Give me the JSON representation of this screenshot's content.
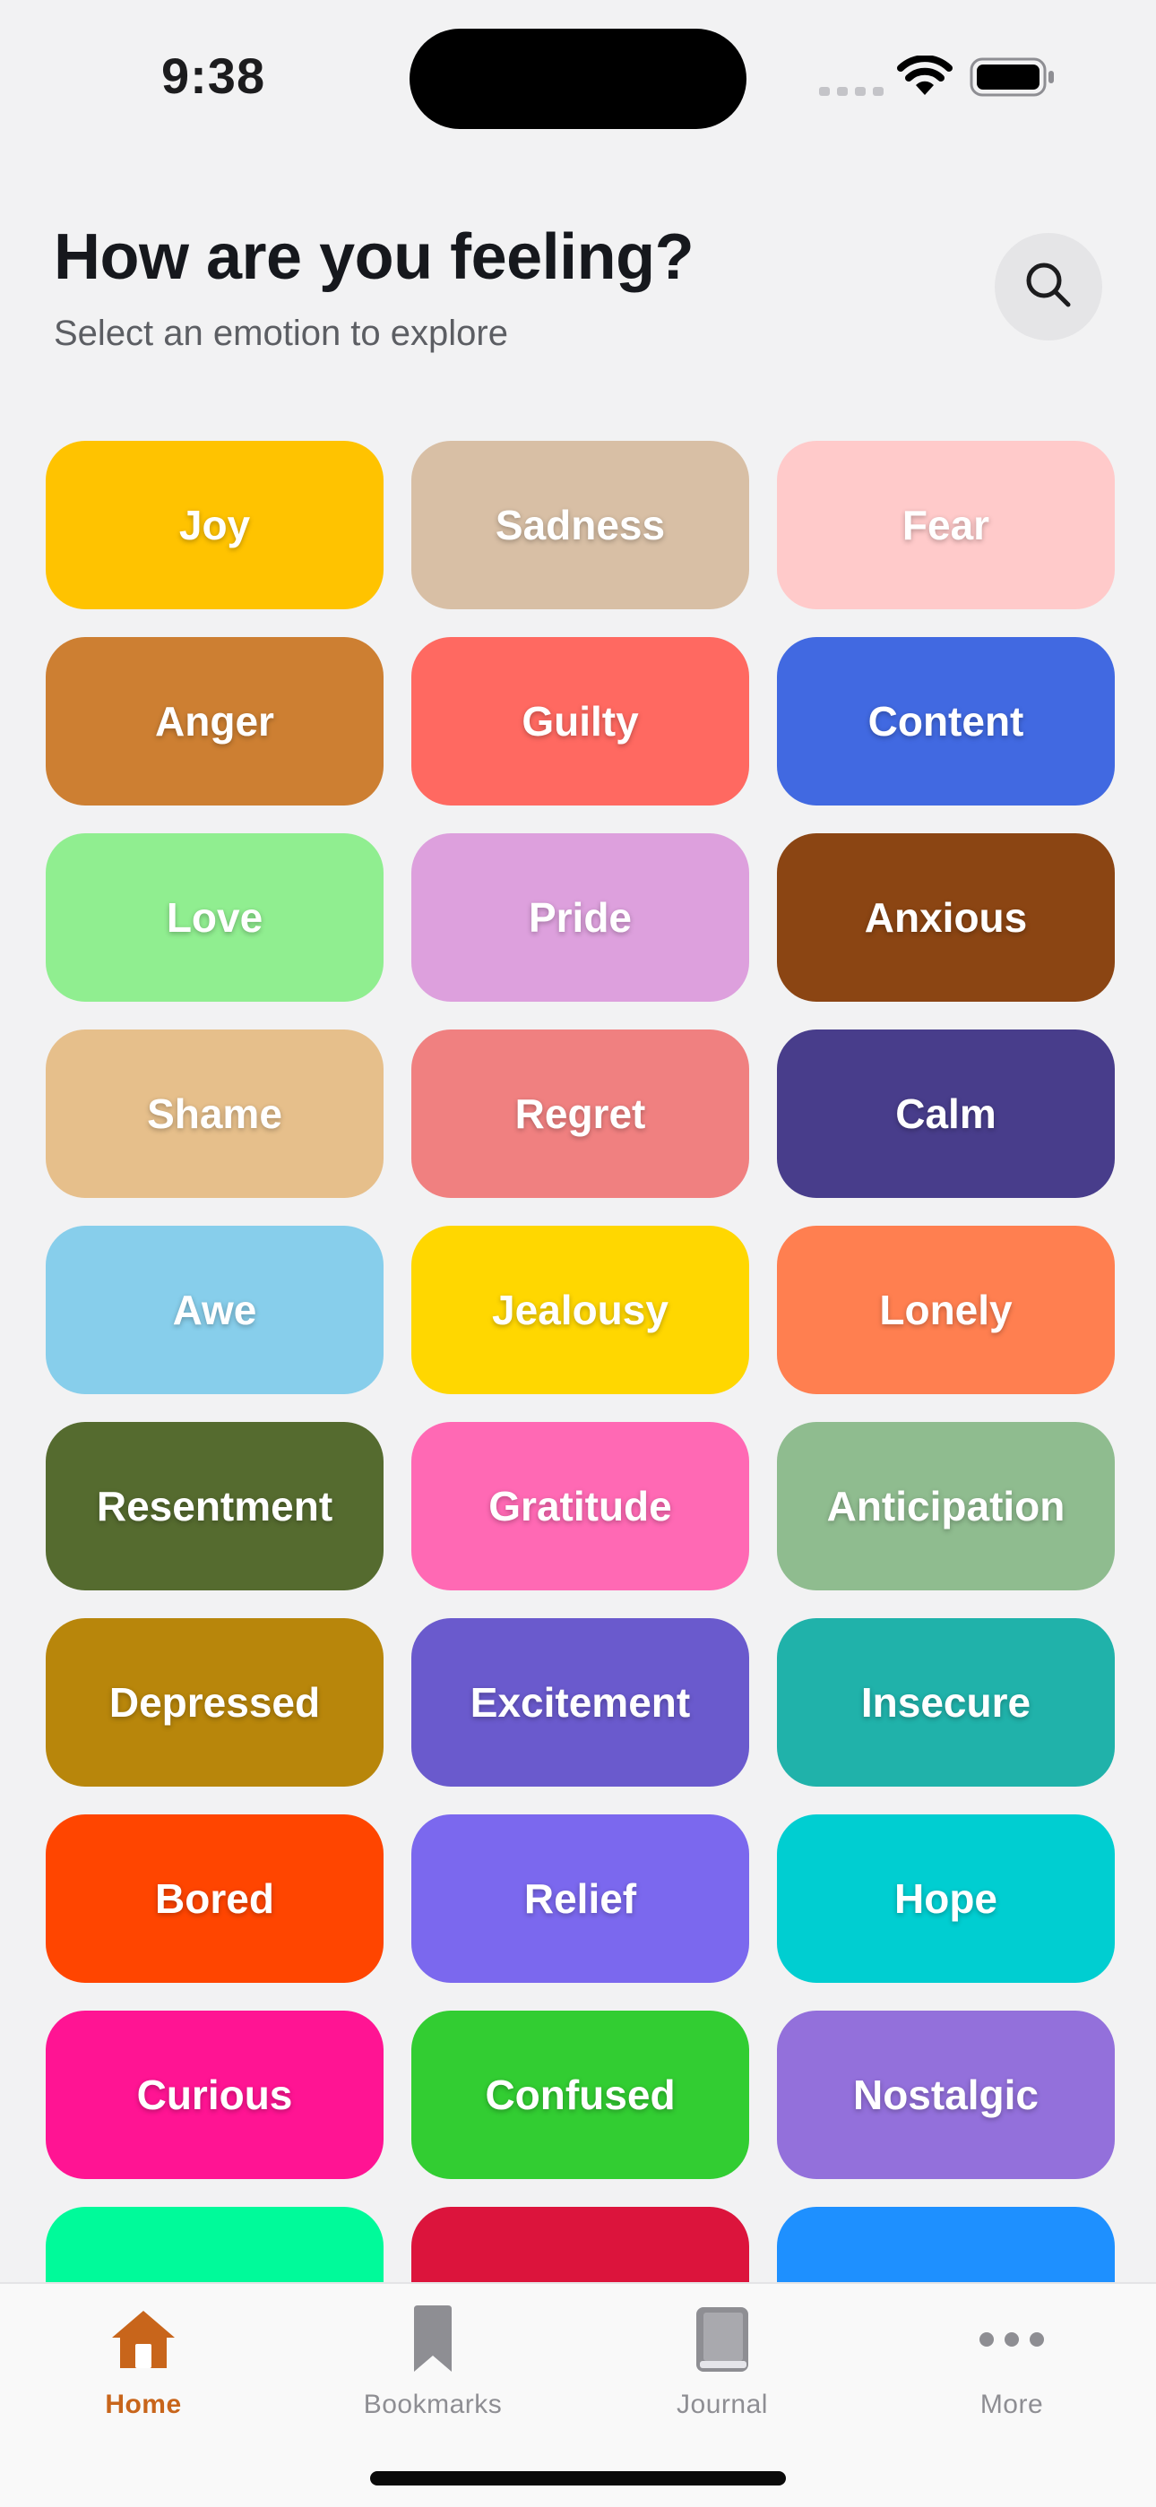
{
  "status_bar": {
    "time": "9:38"
  },
  "header": {
    "title": "How are you feeling?",
    "subtitle": "Select an emotion to explore"
  },
  "icons": {
    "search": "search-icon",
    "home": "home-icon",
    "bookmarks": "bookmark-icon",
    "journal": "book-icon",
    "more": "more-dots-icon"
  },
  "accent_color": "#C8651B",
  "emotions": [
    {
      "label": "Joy",
      "color": "#FFC300"
    },
    {
      "label": "Sadness",
      "color": "#D8BFA5"
    },
    {
      "label": "Fear",
      "color": "#FFCACA"
    },
    {
      "label": "Anger",
      "color": "#CD7F32"
    },
    {
      "label": "Guilty",
      "color": "#FF6961"
    },
    {
      "label": "Content",
      "color": "#4169E1"
    },
    {
      "label": "Love",
      "color": "#90EE90"
    },
    {
      "label": "Pride",
      "color": "#DDA0DD"
    },
    {
      "label": "Anxious",
      "color": "#8B4513"
    },
    {
      "label": "Shame",
      "color": "#E6BF8B"
    },
    {
      "label": "Regret",
      "color": "#F08080"
    },
    {
      "label": "Calm",
      "color": "#483D8B"
    },
    {
      "label": "Awe",
      "color": "#87CEEB"
    },
    {
      "label": "Jealousy",
      "color": "#FFD700"
    },
    {
      "label": "Lonely",
      "color": "#FF7F50"
    },
    {
      "label": "Resentment",
      "color": "#556B2F"
    },
    {
      "label": "Gratitude",
      "color": "#FF69B4"
    },
    {
      "label": "Anticipation",
      "color": "#8FBC8F"
    },
    {
      "label": "Depressed",
      "color": "#B8860B"
    },
    {
      "label": "Excitement",
      "color": "#6A5ACD"
    },
    {
      "label": "Insecure",
      "color": "#20B2AA"
    },
    {
      "label": "Bored",
      "color": "#FF4500"
    },
    {
      "label": "Relief",
      "color": "#7B68EE"
    },
    {
      "label": "Hope",
      "color": "#00CED1"
    },
    {
      "label": "Curious",
      "color": "#FF1493"
    },
    {
      "label": "Confused",
      "color": "#32CD32"
    },
    {
      "label": "Nostalgic",
      "color": "#9370DB"
    },
    {
      "label": "",
      "color": "#00FA9A"
    },
    {
      "label": "",
      "color": "#DC143C"
    },
    {
      "label": "",
      "color": "#1E90FF"
    }
  ],
  "tabs": [
    {
      "label": "Home",
      "active": true
    },
    {
      "label": "Bookmarks",
      "active": false
    },
    {
      "label": "Journal",
      "active": false
    },
    {
      "label": "More",
      "active": false
    }
  ]
}
